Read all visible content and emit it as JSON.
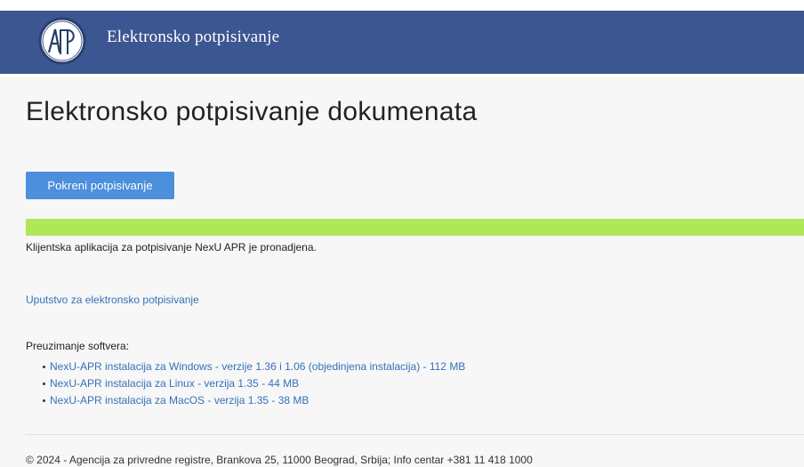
{
  "header": {
    "logo_text": "АПР",
    "title": "Elektronsko potpisivanje"
  },
  "main": {
    "title": "Elektronsko potpisivanje dokumenata",
    "sign_button_label": "Pokreni potpisivanje",
    "status_message": "Klijentska aplikacija za potpisivanje NexU APR je pronadjena.",
    "guide_link": "Uputstvo za elektronsko potpisivanje",
    "downloads_label": "Preuzimanje softvera:",
    "downloads": [
      {
        "label": "NexU-APR instalacija za Windows - verzije 1.36 i 1.06 (objedinjena instalacija) - 112 MB"
      },
      {
        "label": "NexU-APR instalacija za Linux - verzija 1.35 - 44 MB"
      },
      {
        "label": "NexU-APR instalacija za MacOS - verzija 1.35 - 38 MB"
      }
    ]
  },
  "footer": {
    "text": "© 2024 - Agencija za privredne registre, Brankova 25, 11000 Beograd, Srbija; Info centar +381 11 418 1000"
  },
  "colors": {
    "header": "#3c5691",
    "button": "#4c8fdc",
    "status": "#aee758",
    "link": "#3571ba"
  }
}
